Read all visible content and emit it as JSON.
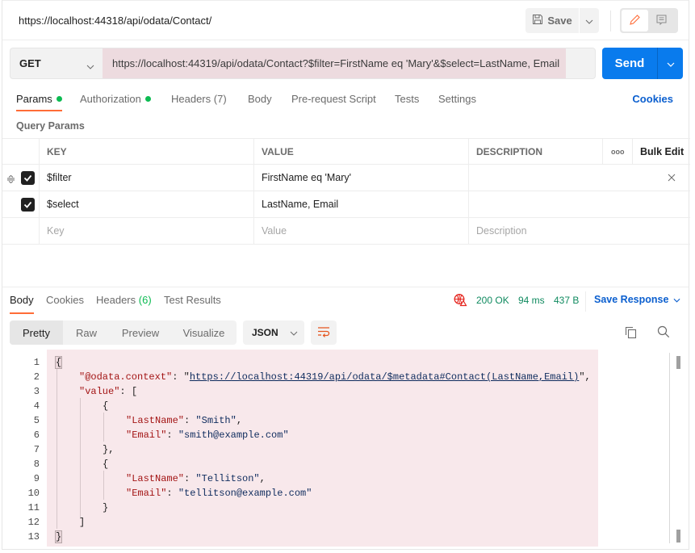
{
  "header": {
    "request_title": "https://localhost:44318/api/odata/Contact/",
    "save_label": "Save"
  },
  "request": {
    "method": "GET",
    "url": "https://localhost:44319/api/odata/Contact?$filter=FirstName eq 'Mary'&$select=LastName, Email",
    "send_label": "Send"
  },
  "request_tabs": {
    "params": "Params",
    "authorization": "Authorization",
    "headers": "Headers",
    "headers_count": "(7)",
    "body": "Body",
    "prerequest": "Pre-request Script",
    "tests": "Tests",
    "settings": "Settings",
    "cookies": "Cookies"
  },
  "query_params": {
    "label": "Query Params",
    "columns": {
      "key": "KEY",
      "value": "VALUE",
      "description": "DESCRIPTION",
      "more": "ooo",
      "bulk_edit": "Bulk Edit"
    },
    "rows": [
      {
        "key": "$filter",
        "value": "FirstName eq 'Mary'",
        "description": "",
        "checked": true
      },
      {
        "key": "$select",
        "value": "LastName, Email",
        "description": "",
        "checked": true
      }
    ],
    "placeholders": {
      "key": "Key",
      "value": "Value",
      "description": "Description"
    }
  },
  "response_tabs": {
    "body": "Body",
    "cookies": "Cookies",
    "headers": "Headers",
    "headers_count": "(6)",
    "test_results": "Test Results"
  },
  "response_status": {
    "code": "200 OK",
    "time": "94 ms",
    "size": "437 B",
    "save_response": "Save Response"
  },
  "view_modes": {
    "pretty": "Pretty",
    "raw": "Raw",
    "preview": "Preview",
    "visualize": "Visualize",
    "format": "JSON"
  },
  "response_body": {
    "line_numbers": [
      "1",
      "2",
      "3",
      "4",
      "5",
      "6",
      "7",
      "8",
      "9",
      "10",
      "11",
      "12",
      "13"
    ],
    "context_key": "\"@odata.context\"",
    "context_url": "https://localhost:44319/api/odata/$metadata#Contact(LastName,Email)",
    "value_key": "\"value\"",
    "records": [
      {
        "last_name_key": "\"LastName\"",
        "last_name": "\"Smith\"",
        "email_key": "\"Email\"",
        "email": "\"smith@example.com\""
      },
      {
        "last_name_key": "\"LastName\"",
        "last_name": "\"Tellitson\"",
        "email_key": "\"Email\"",
        "email": "\"tellitson@example.com\""
      }
    ]
  },
  "colors": {
    "accent": "#ff6c37",
    "send": "#097bed",
    "link": "#0b5fcf",
    "status_ok": "#0f8a5f",
    "indicator_dot": "#0cbb52",
    "error_icon": "#e5261f",
    "json_key": "#a31515",
    "json_string": "#0f2c5e",
    "url_highlight": "#eddbdf",
    "code_highlight": "#f8e8eb"
  }
}
